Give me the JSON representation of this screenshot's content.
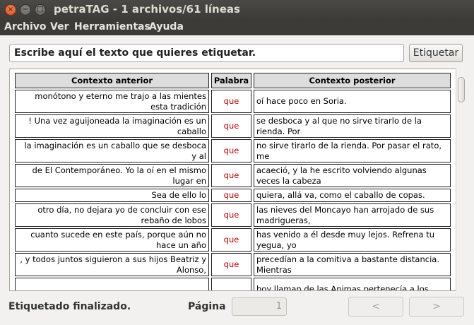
{
  "window": {
    "title": "petraTAG - 1 archivos/61 líneas"
  },
  "menu": {
    "items": [
      "Archivo",
      "Ver",
      "Herramientas",
      "Ayuda"
    ]
  },
  "input": {
    "value": "Escribe aquí el texto que quieres etiquetar."
  },
  "tag_button": {
    "label": "Etiquetar"
  },
  "table": {
    "headers": [
      "Contexto anterior",
      "Palabra",
      "Contexto posterior"
    ],
    "rows": [
      {
        "prev": "monótono y eterno me trajo a las mientes esta tradición",
        "word": "que",
        "post": "oí hace poco en Soria."
      },
      {
        "prev": "! Una vez aguijoneada la imaginación es un caballo",
        "word": "que",
        "post": "se desboca y al que no sirve tirarlo de la rienda. Por"
      },
      {
        "prev": "la imaginación es un caballo que se desboca y al",
        "word": "que",
        "post": "no sirve tirarlo de la rienda. Por pasar el rato, me"
      },
      {
        "prev": "de El Contemporáneo. Yo la oí en el mismo lugar en",
        "word": "que",
        "post": "acaeció, y la he escrito volviendo algunas veces la cabeza"
      },
      {
        "prev": "Sea de ello lo",
        "word": "que",
        "post": "quiera, allá va, como el caballo de copas."
      },
      {
        "prev": "otro día, no dejara yo de concluir con ese rebaño de lobos",
        "word": "que",
        "post": "las nieves del Moncayo han arrojado de sus madrigueras,"
      },
      {
        "prev": "cuanto sucede en este país, porque aún no hace un año",
        "word": "que",
        "post": "has venido a él desde muy lejos. Refrena tu yegua, yo"
      },
      {
        "prev": ", y todos juntos siguieron a sus hijos Beatriz y Alonso,",
        "word": "que",
        "post": "precedían a la comitiva a bastante distancia. Mientras"
      },
      {
        "prev": "",
        "word": "",
        "post": "hoy llaman de las Animas pertenecía a los"
      }
    ]
  },
  "status": {
    "text": "Etiquetado finalizado."
  },
  "pager": {
    "label": "Página",
    "value": "1",
    "prev_label": "<",
    "next_label": ">"
  }
}
